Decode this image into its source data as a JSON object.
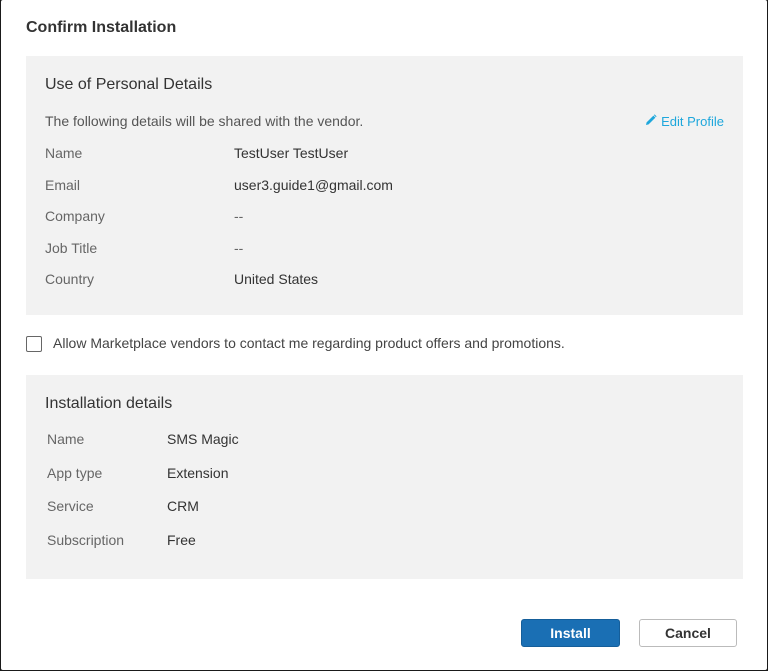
{
  "dialog": {
    "title": "Confirm Installation"
  },
  "personal": {
    "heading": "Use of Personal Details",
    "intro": "The following details will be shared with the vendor.",
    "edit_label": "Edit Profile",
    "rows": [
      {
        "label": "Name",
        "value": "TestUser TestUser"
      },
      {
        "label": "Email",
        "value": "user3.guide1@gmail.com"
      },
      {
        "label": "Company",
        "value": "--"
      },
      {
        "label": "Job Title",
        "value": "--"
      },
      {
        "label": "Country",
        "value": "United States"
      }
    ]
  },
  "consent": {
    "label": "Allow Marketplace vendors to contact me regarding product offers and promotions.",
    "checked": false
  },
  "installation": {
    "heading": "Installation details",
    "rows": [
      {
        "label": "Name",
        "value": "SMS Magic"
      },
      {
        "label": "App type",
        "value": "Extension"
      },
      {
        "label": "Service",
        "value": "CRM"
      },
      {
        "label": "Subscription",
        "value": "Free"
      }
    ]
  },
  "actions": {
    "install_label": "Install",
    "cancel_label": "Cancel"
  },
  "colors": {
    "accent": "#1ea7dc",
    "primary_button": "#1a6fb4",
    "panel_bg": "#f2f2f2"
  },
  "icons": {
    "edit": "pencil-icon"
  }
}
